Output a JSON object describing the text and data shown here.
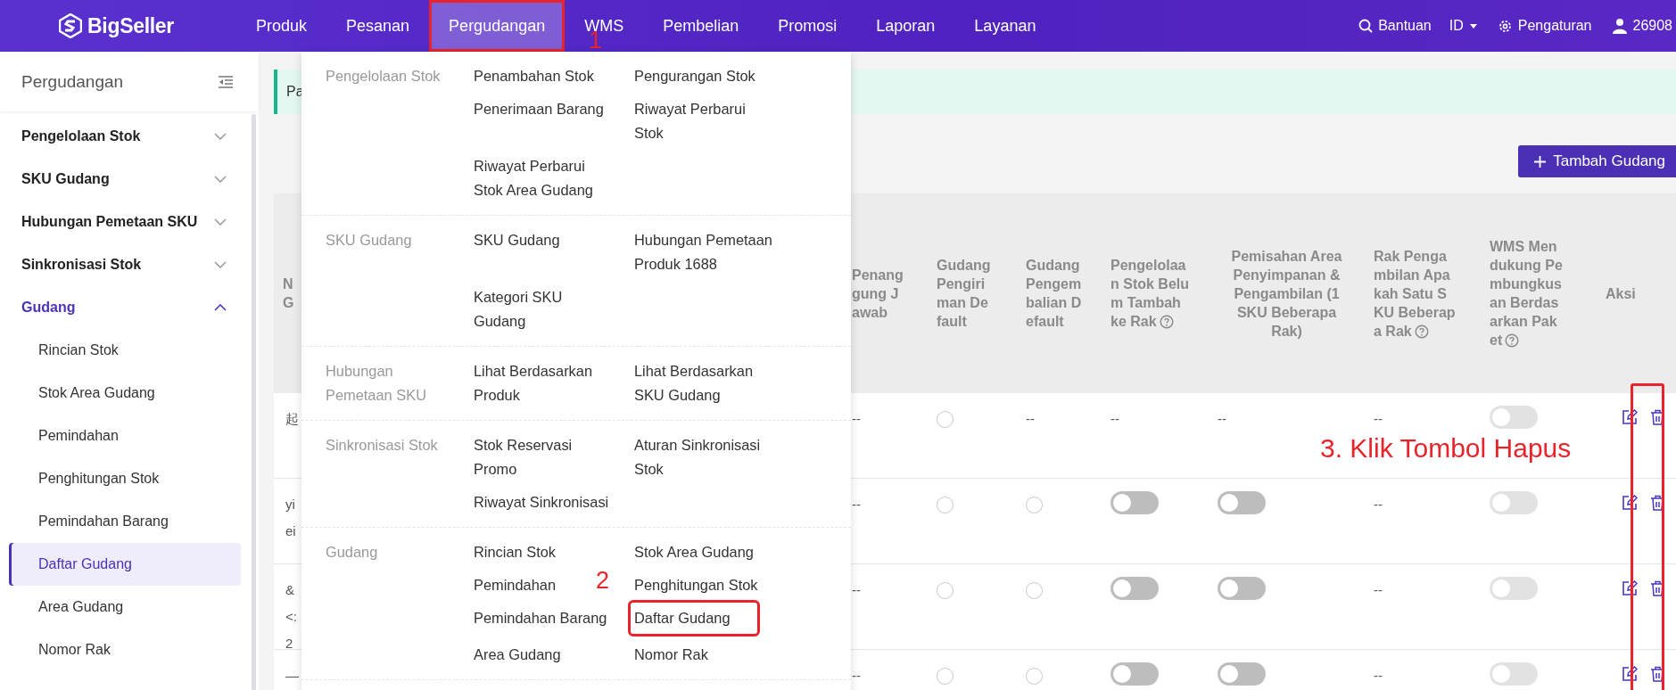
{
  "topbar": {
    "logo": "BigSeller",
    "nav": [
      {
        "label": "Produk",
        "selected": false,
        "highlighted": false
      },
      {
        "label": "Pesanan",
        "selected": false,
        "highlighted": false
      },
      {
        "label": "Pergudangan",
        "selected": true,
        "highlighted": true
      },
      {
        "label": "WMS",
        "selected": false,
        "highlighted": false
      },
      {
        "label": "Pembelian",
        "selected": false,
        "highlighted": false
      },
      {
        "label": "Promosi",
        "selected": false,
        "highlighted": false
      },
      {
        "label": "Laporan",
        "selected": false,
        "highlighted": false
      },
      {
        "label": "Layanan",
        "selected": false,
        "highlighted": false
      }
    ],
    "help": "Bantuan",
    "language": "ID",
    "settings": "Pengaturan",
    "user": "26908"
  },
  "sidebar": {
    "title": "Pergudangan",
    "groups": [
      {
        "label": "Pengelolaan Stok",
        "expanded": false
      },
      {
        "label": "SKU Gudang",
        "expanded": false
      },
      {
        "label": "Hubungan Pemetaan SKU",
        "expanded": false
      },
      {
        "label": "Sinkronisasi Stok",
        "expanded": false
      },
      {
        "label": "Gudang",
        "expanded": true,
        "children": [
          {
            "label": "Rincian Stok",
            "selected": false
          },
          {
            "label": "Stok Area Gudang",
            "selected": false
          },
          {
            "label": "Pemindahan",
            "selected": false
          },
          {
            "label": "Penghitungan Stok",
            "selected": false
          },
          {
            "label": "Pemindahan Barang",
            "selected": false
          },
          {
            "label": "Daftar Gudang",
            "selected": true
          },
          {
            "label": "Area Gudang",
            "selected": false
          },
          {
            "label": "Nomor Rak",
            "selected": false
          }
        ]
      }
    ]
  },
  "notice": {
    "text": "Pa"
  },
  "add_button": "Tambah Gudang",
  "table": {
    "actions_highlighted": true,
    "columns": [
      {
        "label": "N\nG",
        "help": false
      },
      {
        "label": "Penanggung Jawab",
        "help": false
      },
      {
        "label": "Gudang Pengiriman Default",
        "help": false
      },
      {
        "label": "Gudang Pengembalian Default",
        "help": false
      },
      {
        "label": "Pengelolaan Stok Belum Tambah ke Rak",
        "help": true
      },
      {
        "label": "Pemisahan Area Penyimpanan & Pengambilan (1 SKU Beberapa Rak)",
        "help": false
      },
      {
        "label": "Rak Pengambilan Apakah Satu SKU Beberapa Rak",
        "help": true
      },
      {
        "label": "WMS Mendukung Pembungkusan Berdasarkan Paket",
        "help": true
      },
      {
        "label": "Aksi",
        "help": false
      }
    ],
    "rows": [
      {
        "cells": [
          {
            "kind": "text",
            "text": "起"
          },
          {
            "kind": "text",
            "text": "--"
          },
          {
            "kind": "radio",
            "checked": false
          },
          {
            "kind": "text",
            "text": "--"
          },
          {
            "kind": "text",
            "text": "--"
          },
          {
            "kind": "text",
            "text": "--"
          },
          {
            "kind": "text",
            "text": "--"
          },
          {
            "kind": "toggle",
            "on": false,
            "disabled": true
          },
          {
            "kind": "actions"
          }
        ]
      },
      {
        "cells": [
          {
            "kind": "text",
            "text": "yi\nei"
          },
          {
            "kind": "text",
            "text": "--"
          },
          {
            "kind": "radio",
            "checked": false
          },
          {
            "kind": "radio",
            "checked": false
          },
          {
            "kind": "toggle",
            "on": false,
            "disabled": false
          },
          {
            "kind": "toggle",
            "on": false,
            "disabled": false
          },
          {
            "kind": "text",
            "text": "--"
          },
          {
            "kind": "toggle",
            "on": false,
            "disabled": true
          },
          {
            "kind": "actions"
          }
        ]
      },
      {
        "cells": [
          {
            "kind": "text",
            "text": "&\n<:\n2"
          },
          {
            "kind": "text",
            "text": "--"
          },
          {
            "kind": "radio",
            "checked": false
          },
          {
            "kind": "radio",
            "checked": false
          },
          {
            "kind": "toggle",
            "on": false,
            "disabled": false
          },
          {
            "kind": "toggle",
            "on": false,
            "disabled": false
          },
          {
            "kind": "text",
            "text": "--"
          },
          {
            "kind": "toggle",
            "on": false,
            "disabled": true
          },
          {
            "kind": "actions"
          }
        ]
      },
      {
        "cells": [
          {
            "kind": "text",
            "text": "—"
          },
          {
            "kind": "text",
            "text": "--"
          },
          {
            "kind": "radio",
            "checked": false
          },
          {
            "kind": "radio",
            "checked": false
          },
          {
            "kind": "toggle",
            "on": false,
            "disabled": false
          },
          {
            "kind": "toggle",
            "on": false,
            "disabled": false
          },
          {
            "kind": "text",
            "text": "--"
          },
          {
            "kind": "toggle",
            "on": false,
            "disabled": true
          },
          {
            "kind": "actions"
          }
        ]
      }
    ]
  },
  "menu": {
    "sections": [
      {
        "label": "Pengelolaan Stok",
        "items": [
          {
            "label": "Penambahan Stok",
            "highlighted": false
          },
          {
            "label": "Pengurangan Stok",
            "highlighted": false
          },
          {
            "label": "Penerimaan Barang",
            "highlighted": false
          },
          {
            "label": "Riwayat Perbarui Stok",
            "highlighted": false
          },
          {
            "label": "Riwayat Perbarui Stok Area Gudang",
            "highlighted": false
          }
        ]
      },
      {
        "label": "SKU Gudang",
        "items": [
          {
            "label": "SKU Gudang",
            "highlighted": false
          },
          {
            "label": "Hubungan Pemetaan Produk 1688",
            "highlighted": false
          },
          {
            "label": "Kategori SKU Gudang",
            "highlighted": false
          }
        ]
      },
      {
        "label": "Hubungan Pemetaan SKU",
        "items": [
          {
            "label": "Lihat Berdasarkan Produk",
            "highlighted": false
          },
          {
            "label": "Lihat Berdasarkan SKU Gudang",
            "highlighted": false
          }
        ]
      },
      {
        "label": "Sinkronisasi Stok",
        "items": [
          {
            "label": "Stok Reservasi Promo",
            "highlighted": false
          },
          {
            "label": "Aturan Sinkronisasi Stok",
            "highlighted": false
          },
          {
            "label": "Riwayat Sinkronisasi",
            "highlighted": false
          }
        ]
      },
      {
        "label": "Gudang",
        "items": [
          {
            "label": "Rincian Stok",
            "highlighted": false
          },
          {
            "label": "Stok Area Gudang",
            "highlighted": false
          },
          {
            "label": "Pemindahan",
            "highlighted": false
          },
          {
            "label": "Penghitungan Stok",
            "highlighted": false
          },
          {
            "label": "Pemindahan Barang",
            "highlighted": false
          },
          {
            "label": "Daftar Gudang",
            "highlighted": true
          },
          {
            "label": "Area Gudang",
            "highlighted": false
          },
          {
            "label": "Nomor Rak",
            "highlighted": false
          }
        ]
      }
    ]
  },
  "annotations": [
    {
      "kind": "number",
      "text": "1"
    },
    {
      "kind": "number",
      "text": "2"
    },
    {
      "kind": "callout",
      "text": "3. Klik Tombol Hapus"
    }
  ]
}
